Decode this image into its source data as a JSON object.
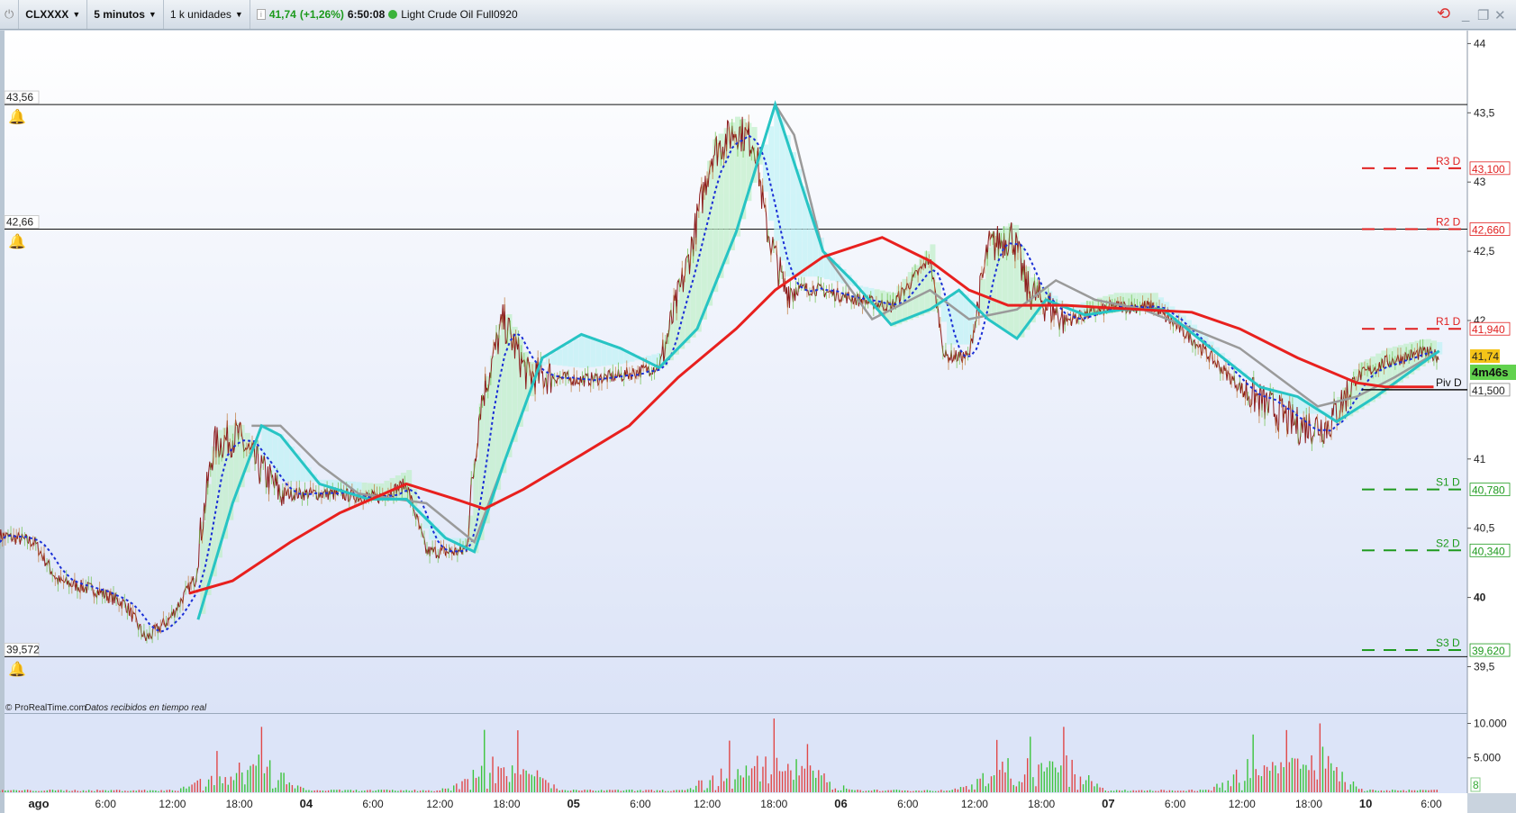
{
  "toolbar": {
    "symbol": "CLXXXX",
    "timeframe": "5 minutos",
    "units": "1 k unidades",
    "price": "41,74",
    "change": "(+1,26%)",
    "time": "6:50:08",
    "instrument": "Light Crude Oil Full0920"
  },
  "footer": {
    "copyright": "© ProRealTime.com",
    "status": "Datos recibidos en tiempo real"
  },
  "colors": {
    "price": "#8b1a1a",
    "ma_red": "#e8201e",
    "ma_cyan": "#27c4c4",
    "ma_gray": "#9a9a9a",
    "dotted": "#1a2fd6",
    "up": "#3cc43c",
    "down": "#e04848"
  },
  "chart_data": {
    "type": "line",
    "ylim": [
      39.2,
      44.1
    ],
    "y_ticks": [
      {
        "v": 44,
        "label": "44"
      },
      {
        "v": 43.5,
        "label": "43,5"
      },
      {
        "v": 43,
        "label": "43"
      },
      {
        "v": 42.5,
        "label": "42,5"
      },
      {
        "v": 42,
        "label": "42"
      },
      {
        "v": 41,
        "label": "41"
      },
      {
        "v": 40.5,
        "label": "40,5"
      },
      {
        "v": 40,
        "label": "40"
      },
      {
        "v": 39.5,
        "label": "39,5"
      }
    ],
    "x_ticks": [
      {
        "h": 0,
        "label": "ago",
        "bold": true
      },
      {
        "h": 6,
        "label": "6:00"
      },
      {
        "h": 12,
        "label": "12:00"
      },
      {
        "h": 18,
        "label": "18:00"
      },
      {
        "h": 24,
        "label": "04",
        "bold": true
      },
      {
        "h": 30,
        "label": "6:00"
      },
      {
        "h": 36,
        "label": "12:00"
      },
      {
        "h": 42,
        "label": "18:00"
      },
      {
        "h": 48,
        "label": "05",
        "bold": true
      },
      {
        "h": 54,
        "label": "6:00"
      },
      {
        "h": 60,
        "label": "12:00"
      },
      {
        "h": 66,
        "label": "18:00"
      },
      {
        "h": 72,
        "label": "06",
        "bold": true
      },
      {
        "h": 78,
        "label": "6:00"
      },
      {
        "h": 84,
        "label": "12:00"
      },
      {
        "h": 90,
        "label": "18:00"
      },
      {
        "h": 96,
        "label": "07",
        "bold": true
      },
      {
        "h": 102,
        "label": "6:00"
      },
      {
        "h": 108,
        "label": "12:00"
      },
      {
        "h": 114,
        "label": "18:00"
      },
      {
        "h": 119.1,
        "label": "10",
        "bold": true
      },
      {
        "h": 125,
        "label": "6:00"
      }
    ],
    "alert_lines": [
      {
        "v": 43.56,
        "label": "43,56"
      },
      {
        "v": 42.66,
        "label": "42,66"
      },
      {
        "v": 39.572,
        "label": "39,572"
      }
    ],
    "pivots": [
      {
        "name": "R3 D",
        "v": 43.1,
        "label": "43,100",
        "color": "#e02020"
      },
      {
        "name": "R2 D",
        "v": 42.66,
        "label": "42,660",
        "color": "#e02020"
      },
      {
        "name": "R1 D",
        "v": 41.94,
        "label": "41,940",
        "color": "#e02020"
      },
      {
        "name": "Piv D",
        "v": 41.5,
        "label": "41,500",
        "color": "#111111"
      },
      {
        "name": "S1 D",
        "v": 40.78,
        "label": "40,780",
        "color": "#1e9a1e"
      },
      {
        "name": "S2 D",
        "v": 40.34,
        "label": "40,340",
        "color": "#1e9a1e"
      },
      {
        "name": "S3 D",
        "v": 39.62,
        "label": "39,620",
        "color": "#1e9a1e"
      }
    ],
    "last_price": {
      "v": 41.74,
      "label": "41,74",
      "countdown": "4m46s"
    },
    "price": [
      [
        -3.5,
        40.45
      ],
      [
        -0.4,
        40.4
      ],
      [
        1.7,
        40.12
      ],
      [
        5.2,
        40.05
      ],
      [
        7.8,
        39.95
      ],
      [
        9.6,
        39.7
      ],
      [
        11.7,
        39.84
      ],
      [
        13.9,
        40.12
      ],
      [
        15.7,
        41.1
      ],
      [
        17.8,
        41.17
      ],
      [
        19.6,
        40.96
      ],
      [
        21.7,
        40.75
      ],
      [
        26.1,
        40.75
      ],
      [
        30.4,
        40.72
      ],
      [
        33,
        40.82
      ],
      [
        34.8,
        40.33
      ],
      [
        38.3,
        40.33
      ],
      [
        39.6,
        41.38
      ],
      [
        41.7,
        42.0
      ],
      [
        43.9,
        41.6
      ],
      [
        45.2,
        41.6
      ],
      [
        48.7,
        41.57
      ],
      [
        52.2,
        41.6
      ],
      [
        55.7,
        41.67
      ],
      [
        58.3,
        42.43
      ],
      [
        60.4,
        43.2
      ],
      [
        62.6,
        43.38
      ],
      [
        64.3,
        43.28
      ],
      [
        65.2,
        42.72
      ],
      [
        66.9,
        42.23
      ],
      [
        69.6,
        42.23
      ],
      [
        73,
        42.16
      ],
      [
        76.5,
        42.1
      ],
      [
        80,
        42.45
      ],
      [
        81.3,
        41.74
      ],
      [
        83.5,
        41.74
      ],
      [
        85.2,
        42.52
      ],
      [
        87.4,
        42.62
      ],
      [
        88.7,
        42.23
      ],
      [
        92.2,
        42.0
      ],
      [
        96.5,
        42.1
      ],
      [
        100,
        42.1
      ],
      [
        103.5,
        41.87
      ],
      [
        107.8,
        41.52
      ],
      [
        110.4,
        41.38
      ],
      [
        113,
        41.24
      ],
      [
        115.7,
        41.24
      ],
      [
        118.3,
        41.59
      ],
      [
        120.9,
        41.7
      ],
      [
        124.3,
        41.77
      ],
      [
        125.7,
        41.74
      ]
    ],
    "ma_red": [
      [
        13.5,
        40.03
      ],
      [
        17.4,
        40.12
      ],
      [
        22.6,
        40.4
      ],
      [
        27,
        40.61
      ],
      [
        33,
        40.82
      ],
      [
        37.4,
        40.71
      ],
      [
        40,
        40.64
      ],
      [
        43.5,
        40.78
      ],
      [
        48.7,
        41.03
      ],
      [
        53,
        41.24
      ],
      [
        57.4,
        41.59
      ],
      [
        62.6,
        41.94
      ],
      [
        66.1,
        42.22
      ],
      [
        70.4,
        42.46
      ],
      [
        75.7,
        42.6
      ],
      [
        80,
        42.43
      ],
      [
        83.5,
        42.22
      ],
      [
        87,
        42.11
      ],
      [
        92.2,
        42.11
      ],
      [
        96.5,
        42.09
      ],
      [
        103.5,
        42.06
      ],
      [
        107.8,
        41.94
      ],
      [
        113,
        41.73
      ],
      [
        118.3,
        41.55
      ],
      [
        120.9,
        41.52
      ],
      [
        125.2,
        41.52
      ]
    ],
    "ma_cyan": [
      [
        14.3,
        39.84
      ],
      [
        17.4,
        40.68
      ],
      [
        20,
        41.24
      ],
      [
        21.7,
        41.17
      ],
      [
        25.2,
        40.82
      ],
      [
        29.6,
        40.71
      ],
      [
        33,
        40.71
      ],
      [
        36.5,
        40.43
      ],
      [
        39.1,
        40.33
      ],
      [
        41.7,
        40.96
      ],
      [
        45.2,
        41.73
      ],
      [
        48.7,
        41.9
      ],
      [
        52.2,
        41.8
      ],
      [
        55.7,
        41.66
      ],
      [
        59.1,
        41.94
      ],
      [
        62.6,
        42.64
      ],
      [
        66.1,
        43.56
      ],
      [
        68.7,
        42.92
      ],
      [
        70.4,
        42.5
      ],
      [
        73,
        42.29
      ],
      [
        76.5,
        41.97
      ],
      [
        80,
        42.08
      ],
      [
        82.6,
        42.22
      ],
      [
        85.2,
        42.01
      ],
      [
        87.8,
        41.87
      ],
      [
        90.4,
        42.15
      ],
      [
        93.9,
        42.04
      ],
      [
        97.4,
        42.08
      ],
      [
        100.9,
        42.08
      ],
      [
        105.2,
        41.8
      ],
      [
        109.6,
        41.52
      ],
      [
        113,
        41.45
      ],
      [
        116.5,
        41.27
      ],
      [
        120,
        41.45
      ],
      [
        125.7,
        41.78
      ]
    ],
    "ma_gray": [
      [
        19.1,
        41.24
      ],
      [
        21.7,
        41.24
      ],
      [
        25.2,
        40.96
      ],
      [
        28.7,
        40.75
      ],
      [
        34.8,
        40.68
      ],
      [
        39.1,
        40.4
      ],
      [
        41.7,
        40.96
      ],
      [
        45.2,
        41.73
      ],
      [
        48.7,
        41.9
      ],
      [
        52.2,
        41.8
      ],
      [
        55.7,
        41.66
      ],
      [
        59.1,
        41.94
      ],
      [
        62.6,
        42.64
      ],
      [
        66.1,
        43.56
      ],
      [
        67.8,
        43.34
      ],
      [
        70.4,
        42.5
      ],
      [
        74.8,
        42.01
      ],
      [
        80,
        42.22
      ],
      [
        83.5,
        42.01
      ],
      [
        87.8,
        42.08
      ],
      [
        91.3,
        42.29
      ],
      [
        94.8,
        42.15
      ],
      [
        99.1,
        42.08
      ],
      [
        103.5,
        41.94
      ],
      [
        107.8,
        41.8
      ],
      [
        111.3,
        41.59
      ],
      [
        114.8,
        41.38
      ],
      [
        118.3,
        41.45
      ],
      [
        121.7,
        41.59
      ],
      [
        125.7,
        41.78
      ]
    ],
    "volume": {
      "y_ticks": [
        {
          "v": 10000,
          "label": "10.000"
        },
        {
          "v": 5000,
          "label": "5.000"
        }
      ],
      "last_label": "8",
      "ylim": [
        0,
        11500
      ],
      "peaks": [
        [
          16,
          6000
        ],
        [
          20,
          9500
        ],
        [
          40,
          8500
        ],
        [
          43,
          9000
        ],
        [
          62,
          7500
        ],
        [
          66,
          10000
        ],
        [
          69,
          7000
        ],
        [
          86,
          6500
        ],
        [
          89,
          8000
        ],
        [
          92,
          9500
        ],
        [
          109,
          8000
        ],
        [
          112,
          9000
        ],
        [
          115,
          10000
        ]
      ]
    }
  }
}
